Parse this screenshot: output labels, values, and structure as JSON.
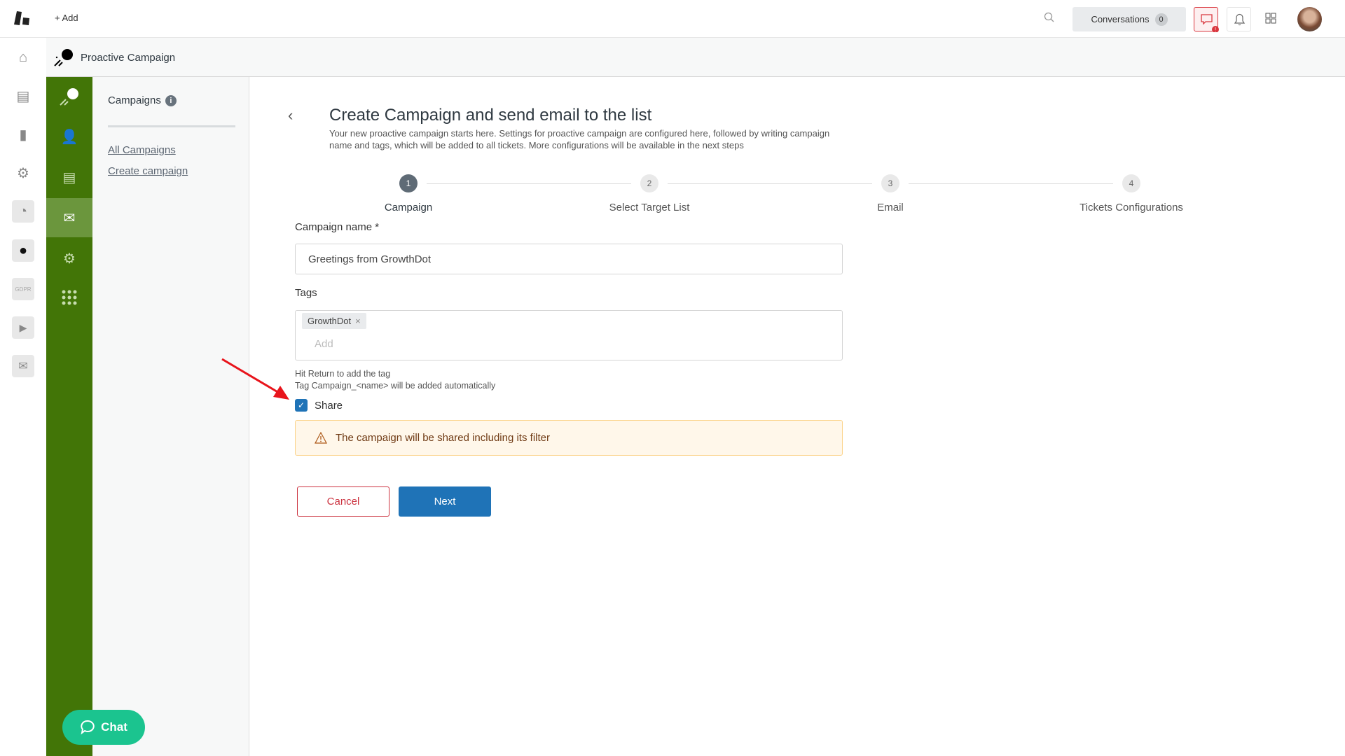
{
  "topbar": {
    "add_label": "Add",
    "conversations_label": "Conversations",
    "conversations_count": "0",
    "alert_color": "#d9363e"
  },
  "header": {
    "title": "Proactive Campaign"
  },
  "secondary": {
    "title": "Campaigns",
    "links": [
      {
        "label": "All Campaigns"
      },
      {
        "label": "Create campaign"
      }
    ]
  },
  "page": {
    "title": "Create Campaign and send email to the list",
    "subtitle_line1": "Your new proactive campaign starts here. Settings for proactive campaign are configured here, followed by writing campaign",
    "subtitle_line2": "name and tags, which will be added to all tickets. More configurations will be available in the next steps"
  },
  "stepper": {
    "current": 1,
    "steps": [
      {
        "number": "1",
        "label": "Campaign"
      },
      {
        "number": "2",
        "label": "Select Target List"
      },
      {
        "number": "3",
        "label": "Email"
      },
      {
        "number": "4",
        "label": "Tickets Configurations"
      }
    ]
  },
  "form": {
    "name_label": "Campaign name *",
    "name_value": "Greetings from GrowthDot",
    "tags_label": "Tags",
    "tags": [
      "GrowthDot"
    ],
    "tags_placeholder": "Add",
    "hint1": "Hit Return to add the tag",
    "hint2": "Tag Campaign_<name> will be added automatically",
    "share_label": "Share",
    "share_checked": true,
    "warning": "The campaign will be shared including its filter",
    "cancel_label": "Cancel",
    "next_label": "Next"
  },
  "chat": {
    "label": "Chat"
  },
  "colors": {
    "green_sidebar": "#427507",
    "primary": "#1f73b7",
    "chat": "#1bc48f"
  }
}
